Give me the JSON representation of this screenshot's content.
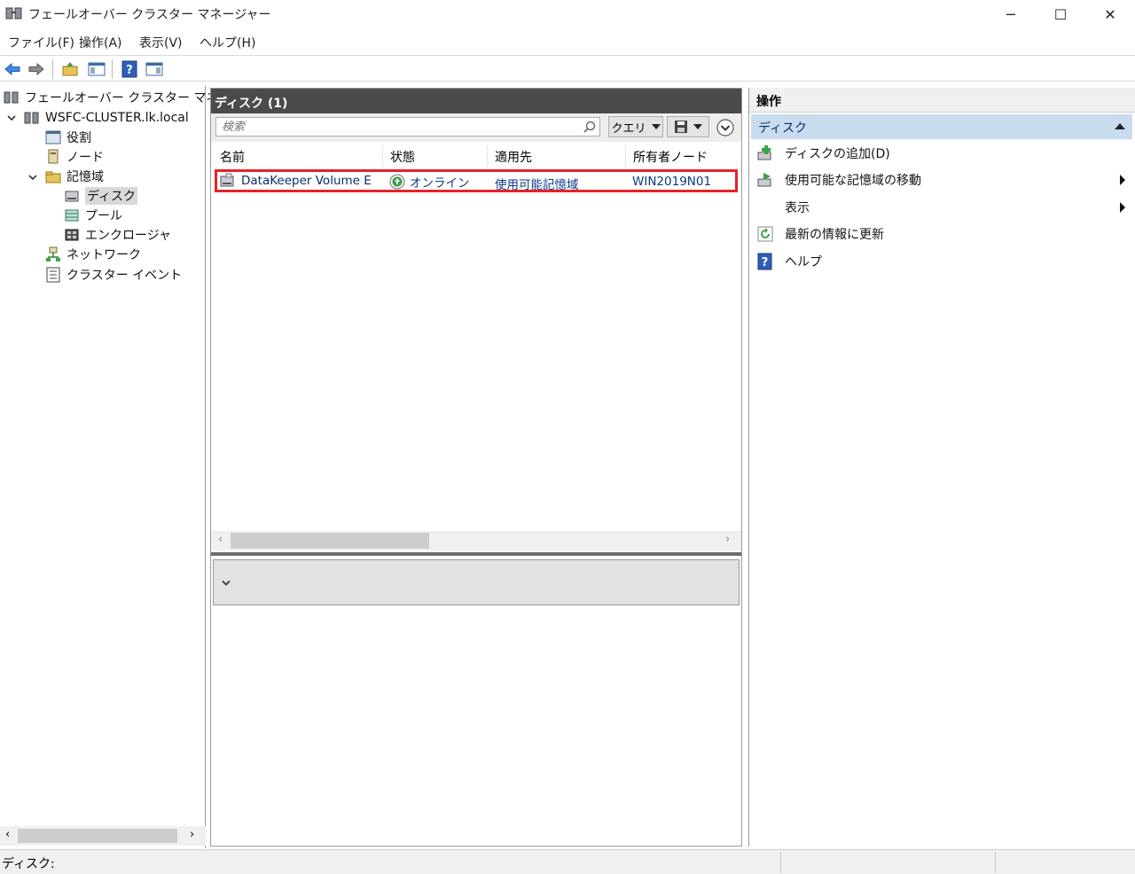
{
  "window": {
    "title": "フェールオーバー クラスター マネージャー",
    "minimize": "─",
    "maximize": "☐",
    "close": "✕"
  },
  "menu": [
    "ファイル(F)",
    "操作(A)",
    "表示(V)",
    "ヘルプ(H)"
  ],
  "tree": {
    "root": "フェールオーバー クラスター マネージャ",
    "cluster": "WSFC-CLUSTER.lk.local",
    "roles": "役割",
    "nodes": "ノード",
    "storage": "記憶域",
    "disks": "ディスク",
    "pools": "プール",
    "enclosures": "エンクロージャ",
    "networks": "ネットワーク",
    "events": "クラスター イベント"
  },
  "center": {
    "header": "ディスク (1)",
    "search_placeholder": "検索",
    "query_label": "クエリ",
    "columns": [
      "名前",
      "状態",
      "適用先",
      "所有者ノード"
    ],
    "rows": [
      {
        "name": "DataKeeper Volume E",
        "status": "オンライン",
        "assigned_to": "使用可能記憶域",
        "owner": "WIN2019N01"
      }
    ]
  },
  "actions": {
    "header": "操作",
    "section": "ディスク",
    "items": [
      {
        "label": "ディスクの追加(D)",
        "icon": "add-disk-icon",
        "submenu": false
      },
      {
        "label": "使用可能な記憶域の移動",
        "icon": "move-storage-icon",
        "submenu": true
      },
      {
        "label": "表示",
        "icon": "",
        "submenu": true
      },
      {
        "label": "最新の情報に更新",
        "icon": "refresh-icon",
        "submenu": false
      },
      {
        "label": "ヘルプ",
        "icon": "help-icon",
        "submenu": false
      }
    ]
  },
  "status": {
    "text": "ディスク:"
  },
  "colors": {
    "accent_header": "#4b4b4b",
    "selection": "#c9dcee",
    "highlight_border": "#e5232a"
  }
}
